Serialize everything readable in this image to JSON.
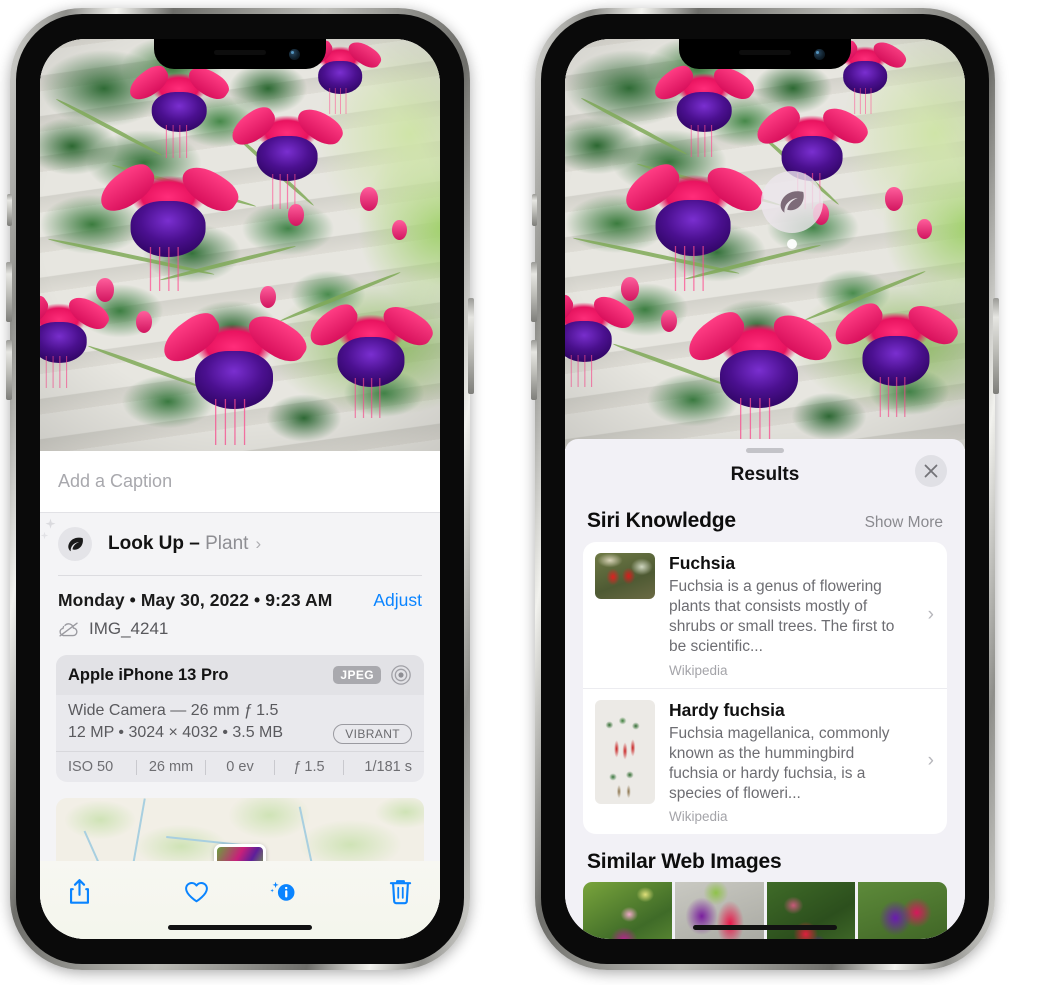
{
  "left_phone": {
    "photo_alt": "fuchsia-plant-photo",
    "caption": {
      "placeholder": "Add a Caption",
      "value": ""
    },
    "lookup": {
      "icon": "leaf-icon",
      "sparkle_icon": "sparkle-icon",
      "label": "Look Up",
      "dash": " – ",
      "subject": "Plant",
      "chevron": "›"
    },
    "date": {
      "weekday": "Monday",
      "full_line": "Monday • May 30, 2022 • 9:23 AM",
      "adjust_label": "Adjust"
    },
    "file": {
      "icon": "cloud-slash-icon",
      "name": "IMG_4241"
    },
    "exif": {
      "device": "Apple iPhone 13 Pro",
      "format_badge": "JPEG",
      "aperture_icon": "aperture-icon",
      "lens_line": "Wide Camera — 26 mm ƒ 1.5",
      "size_line": "12 MP • 3024 × 4032 • 3.5 MB",
      "style_badge": "VIBRANT",
      "stats": [
        "ISO 50",
        "26 mm",
        "0 ev",
        "ƒ 1.5",
        "1/181 s"
      ]
    },
    "map": {
      "pin_icon": "photo-pin"
    },
    "toolbar": [
      {
        "name": "share-icon",
        "label": "Share"
      },
      {
        "name": "heart-icon",
        "label": "Favorite"
      },
      {
        "name": "info-sparkle-icon",
        "label": "Info"
      },
      {
        "name": "trash-icon",
        "label": "Delete"
      }
    ]
  },
  "right_phone": {
    "photo_badge": {
      "icon": "leaf-icon",
      "name": "visual-lookup-badge"
    },
    "sheet": {
      "grabber": true,
      "title": "Results",
      "close_icon": "close-icon"
    },
    "siri_knowledge": {
      "heading": "Siri Knowledge",
      "show_more": "Show More",
      "items": [
        {
          "title": "Fuchsia",
          "desc": "Fuchsia is a genus of flowering plants that consists mostly of shrubs or small trees. The first to be scientific...",
          "source": "Wikipedia",
          "thumb": "fuchsia-red-flowers-thumb",
          "chevron": "›"
        },
        {
          "title": "Hardy fuchsia",
          "desc": "Fuchsia magellanica, commonly known as the hummingbird fuchsia or hardy fuchsia, is a species of floweri...",
          "source": "Wikipedia",
          "thumb": "hardy-fuchsia-specimen-thumb",
          "chevron": "›"
        }
      ]
    },
    "similar_web_images": {
      "heading": "Similar Web Images",
      "thumbs": [
        "fuchsia-web-image-1",
        "fuchsia-web-image-2",
        "fuchsia-web-image-3",
        "fuchsia-web-image-4"
      ]
    }
  },
  "colors": {
    "accent_blue": "#0a84ff",
    "sheet_bg": "#f2f1f6",
    "card_bg": "#ffffff",
    "exif_card": "#e9e9ed",
    "secondary_text": "#8e8e93"
  }
}
